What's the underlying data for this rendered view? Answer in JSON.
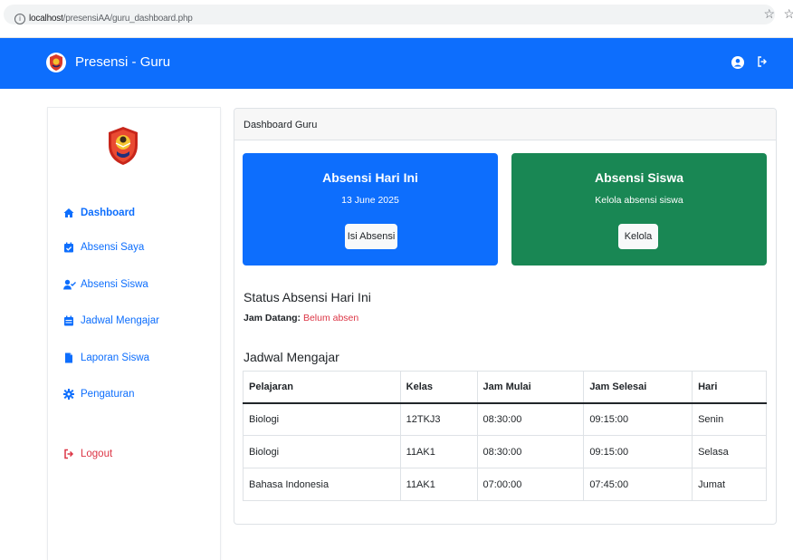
{
  "browser": {
    "url_host": "localhost",
    "url_path": "/presensiAA/guru_dashboard.php"
  },
  "navbar": {
    "brand": "Presensi - Guru",
    "color": "#0d6efd"
  },
  "sidebar": {
    "items": [
      {
        "label": "Dashboard",
        "icon": "home-icon"
      },
      {
        "label": "Absensi Saya",
        "icon": "calendar-check-icon"
      },
      {
        "label": "Absensi Siswa",
        "icon": "user-check-icon"
      },
      {
        "label": "Jadwal Mengajar",
        "icon": "calendar-icon"
      },
      {
        "label": "Laporan Siswa",
        "icon": "file-icon"
      },
      {
        "label": "Pengaturan",
        "icon": "gear-icon"
      }
    ],
    "logout": {
      "label": "Logout",
      "icon": "sign-out-icon"
    }
  },
  "main": {
    "header": "Dashboard Guru",
    "tile_absensi": {
      "title": "Absensi Hari Ini",
      "date": "13 June 2025",
      "button": "Isi Absensi",
      "color": "#0d6efd"
    },
    "tile_siswa": {
      "title": "Absensi Siswa",
      "subtitle": "Kelola absensi siswa",
      "button": "Kelola",
      "color": "#198754"
    },
    "status": {
      "title": "Status Absensi Hari Ini",
      "label": "Jam Datang:",
      "value": "Belum absen",
      "value_color": "#dc3545"
    },
    "jadwal": {
      "title": "Jadwal Mengajar",
      "columns": [
        "Pelajaran",
        "Kelas",
        "Jam Mulai",
        "Jam Selesai",
        "Hari"
      ],
      "rows": [
        [
          "Biologi",
          "12TKJ3",
          "08:30:00",
          "09:15:00",
          "Senin"
        ],
        [
          "Biologi",
          "11AK1",
          "08:30:00",
          "09:15:00",
          "Selasa"
        ],
        [
          "Bahasa Indonesia",
          "11AK1",
          "07:00:00",
          "07:45:00",
          "Jumat"
        ]
      ]
    }
  }
}
